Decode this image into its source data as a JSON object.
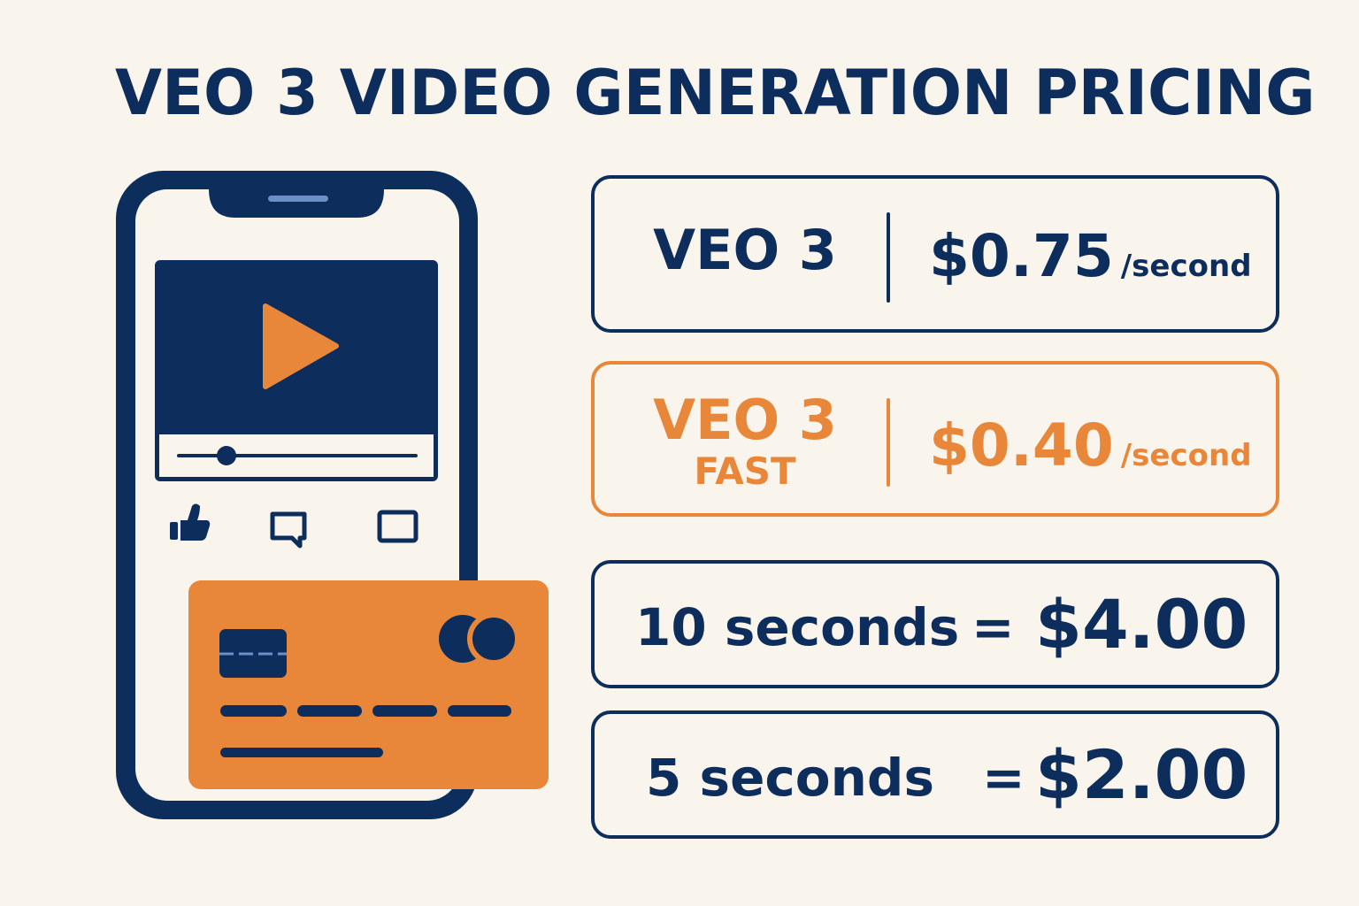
{
  "title": "VEO 3 VIDEO GENERATION PRICING",
  "colors": {
    "background": "#faf5ec",
    "navy": "#0d2d5c",
    "orange": "#e8873a"
  },
  "illustration": {
    "device": "smartphone",
    "screen_content": "video-player",
    "icons": [
      "play-icon",
      "thumbs-up-icon",
      "comment-icon",
      "screen-icon",
      "credit-card-icon"
    ],
    "video_progress": 0.18
  },
  "plans": [
    {
      "name": "VEO 3",
      "subname": "",
      "price": "$0.75",
      "unit": "/second"
    },
    {
      "name": "VEO 3",
      "subname": "FAST",
      "price": "$0.40",
      "unit": "/second"
    }
  ],
  "examples": [
    {
      "duration": "10 seconds",
      "equals": "=",
      "cost": "$4.00"
    },
    {
      "duration": "5 seconds",
      "equals": "=",
      "cost": "$2.00"
    }
  ]
}
